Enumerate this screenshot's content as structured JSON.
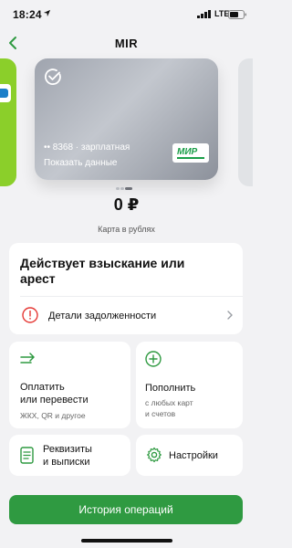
{
  "status_bar": {
    "time": "18:24",
    "network": "LTE",
    "icons": [
      "location-arrow-icon",
      "signal-icon",
      "battery-icon"
    ]
  },
  "nav": {
    "title": "MIR",
    "back_icon": "chevron-left-icon"
  },
  "card": {
    "number_line": "•• 8368 · зарплатная",
    "show_data_label": "Показать данные",
    "logo_text": "МИР",
    "icon": "check-circle-icon"
  },
  "balance": {
    "amount": "0 ₽",
    "caption": "Карта в рублях"
  },
  "arrest": {
    "title": "Действует взыскание или арест",
    "debt_label": "Детали задолженности",
    "icon": "info-icon"
  },
  "tiles": {
    "pay": {
      "title_line1": "Оплатить",
      "title_line2": "или перевести",
      "subtitle": "ЖКХ, QR и другое",
      "icon": "transfer-arrow-icon"
    },
    "topup": {
      "title": "Пополнить",
      "subtitle_line1": "с любых карт",
      "subtitle_line2": "и счетов",
      "icon": "plus-circle-icon"
    },
    "details": {
      "title_line1": "Реквизиты",
      "title_line2": "и выписки",
      "icon": "document-icon"
    },
    "settings": {
      "title": "Настройки",
      "icon": "gear-icon"
    }
  },
  "history_button": "История операций",
  "colors": {
    "accent": "#2f9a41",
    "alert": "#e53935",
    "background": "#f2f2f4",
    "card": "#aeb2ba"
  }
}
